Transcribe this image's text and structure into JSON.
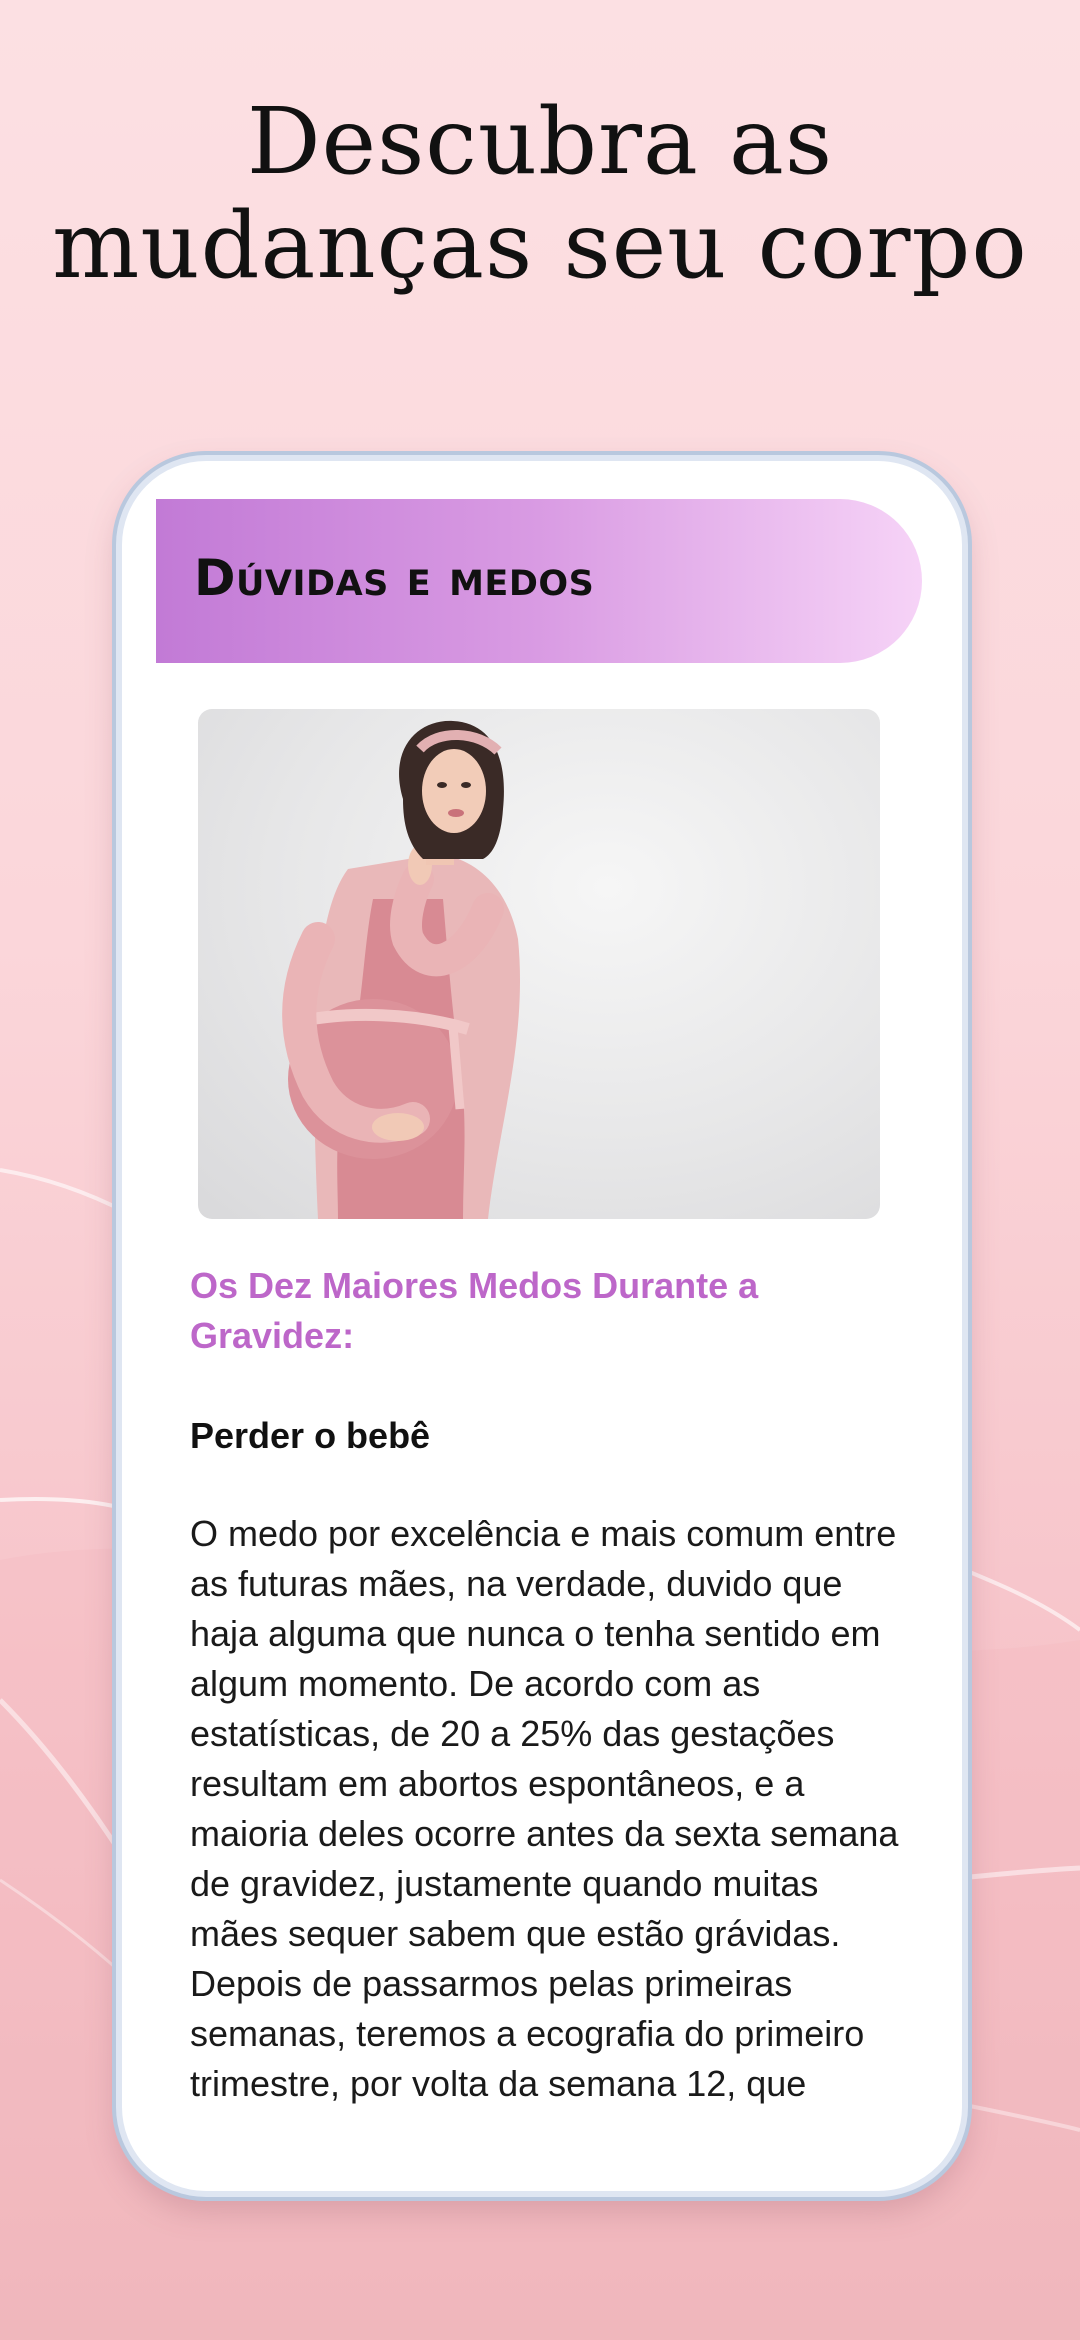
{
  "headline": {
    "line1": "Descubra as",
    "line2": "mudanças seu corpo"
  },
  "screen": {
    "banner_title": "Dúvidas e medos",
    "photo_alt": "pregnant-woman-photo",
    "article": {
      "title": "Os Dez Maiores Medos Durante a Gravidez:",
      "section_heading": "Perder o bebê",
      "body": "O medo por excelência e mais comum entre as futuras mães, na verdade, duvido que haja alguma que nunca o tenha sentido em algum momento. De acordo com as estatísticas, de 20 a 25% das gestações resultam em abortos espontâneos, e a maioria deles ocorre antes da sexta semana de gravidez, justamente quando muitas mães sequer sabem que estão grávidas. Depois de passarmos pelas primeiras semanas, teremos a ecografia do primeiro trimestre, por volta da semana 12, que"
    }
  },
  "colors": {
    "accent": "#bd67c9",
    "banner_start": "#c27ad6",
    "banner_end": "#f6d3f7",
    "background": "#fbd6da"
  }
}
